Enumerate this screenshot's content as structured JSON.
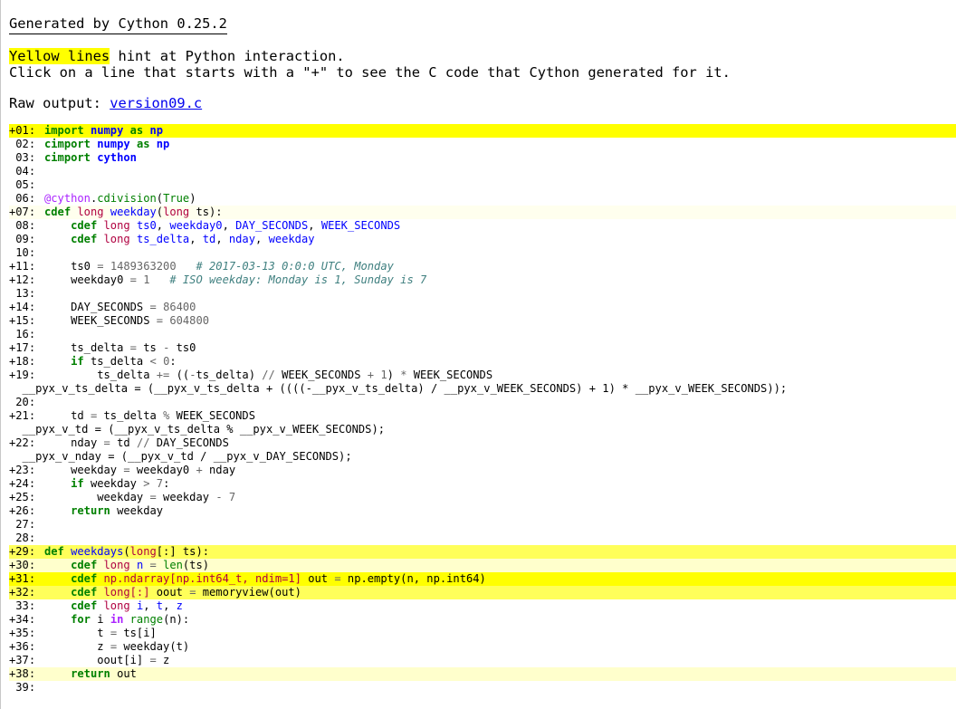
{
  "header": {
    "title": "Generated by Cython 0.25.2",
    "hint_highlight": "Yellow lines",
    "hint_rest": " hint at Python interaction.",
    "hint_line2": "Click on a line that starts with a \"+\" to see the C code that Cython generated for it.",
    "raw_label": "Raw output: ",
    "raw_link": "version09.c"
  },
  "colors": {
    "yellow_strong": "#ffff00",
    "yellow_mid": "#ffff5a",
    "yellow_light": "#ffffcc",
    "yellow_faint": "#ffffee",
    "link": "#0000ee"
  },
  "lines": [
    {
      "no": "+01:",
      "bg": "#ffff00",
      "tokens": [
        [
          "kw",
          "import"
        ],
        [
          "c",
          " "
        ],
        [
          "mod",
          "numpy"
        ],
        [
          "c",
          " "
        ],
        [
          "kw",
          "as"
        ],
        [
          "c",
          " "
        ],
        [
          "mod",
          "np"
        ]
      ]
    },
    {
      "no": " 02:",
      "bg": "",
      "tokens": [
        [
          "kw",
          "cimport"
        ],
        [
          "c",
          " "
        ],
        [
          "mod",
          "numpy"
        ],
        [
          "c",
          " "
        ],
        [
          "kw",
          "as"
        ],
        [
          "c",
          " "
        ],
        [
          "mod",
          "np"
        ]
      ]
    },
    {
      "no": " 03:",
      "bg": "",
      "tokens": [
        [
          "kw",
          "cimport"
        ],
        [
          "c",
          " "
        ],
        [
          "mod",
          "cython"
        ]
      ]
    },
    {
      "no": " 04:",
      "bg": "",
      "tokens": []
    },
    {
      "no": " 05:",
      "bg": "",
      "tokens": []
    },
    {
      "no": " 06:",
      "bg": "",
      "tokens": [
        [
          "deco",
          "@cython"
        ],
        [
          "c",
          "."
        ],
        [
          "bi",
          "cdivision"
        ],
        [
          "c",
          "("
        ],
        [
          "bi",
          "True"
        ],
        [
          "c",
          ")"
        ]
      ]
    },
    {
      "no": "+07:",
      "bg": "#ffffee",
      "tokens": [
        [
          "kw",
          "cdef"
        ],
        [
          "c",
          " "
        ],
        [
          "type",
          "long"
        ],
        [
          "c",
          " "
        ],
        [
          "name",
          "weekday"
        ],
        [
          "c",
          "("
        ],
        [
          "type",
          "long"
        ],
        [
          "c",
          " ts):"
        ]
      ]
    },
    {
      "no": " 08:",
      "bg": "",
      "tokens": [
        [
          "c",
          "    "
        ],
        [
          "kw",
          "cdef"
        ],
        [
          "c",
          " "
        ],
        [
          "type",
          "long"
        ],
        [
          "c",
          " "
        ],
        [
          "name",
          "ts0"
        ],
        [
          "c",
          ", "
        ],
        [
          "name",
          "weekday0"
        ],
        [
          "c",
          ", "
        ],
        [
          "name",
          "DAY_SECONDS"
        ],
        [
          "c",
          ", "
        ],
        [
          "name",
          "WEEK_SECONDS"
        ]
      ]
    },
    {
      "no": " 09:",
      "bg": "",
      "tokens": [
        [
          "c",
          "    "
        ],
        [
          "kw",
          "cdef"
        ],
        [
          "c",
          " "
        ],
        [
          "type",
          "long"
        ],
        [
          "c",
          " "
        ],
        [
          "name",
          "ts_delta"
        ],
        [
          "c",
          ", "
        ],
        [
          "name",
          "td"
        ],
        [
          "c",
          ", "
        ],
        [
          "name",
          "nday"
        ],
        [
          "c",
          ", "
        ],
        [
          "name",
          "weekday"
        ]
      ]
    },
    {
      "no": " 10:",
      "bg": "",
      "tokens": []
    },
    {
      "no": "+11:",
      "bg": "",
      "tokens": [
        [
          "c",
          "    ts0 "
        ],
        [
          "op",
          "="
        ],
        [
          "c",
          " "
        ],
        [
          "num",
          "1489363200"
        ],
        [
          "c",
          "   "
        ],
        [
          "cm",
          "# 2017-03-13 0:0:0 UTC, Monday"
        ]
      ]
    },
    {
      "no": "+12:",
      "bg": "",
      "tokens": [
        [
          "c",
          "    weekday0 "
        ],
        [
          "op",
          "="
        ],
        [
          "c",
          " "
        ],
        [
          "num",
          "1"
        ],
        [
          "c",
          "   "
        ],
        [
          "cm",
          "# ISO weekday: Monday is 1, Sunday is 7"
        ]
      ]
    },
    {
      "no": " 13:",
      "bg": "",
      "tokens": []
    },
    {
      "no": "+14:",
      "bg": "",
      "tokens": [
        [
          "c",
          "    DAY_SECONDS "
        ],
        [
          "op",
          "="
        ],
        [
          "c",
          " "
        ],
        [
          "num",
          "86400"
        ]
      ]
    },
    {
      "no": "+15:",
      "bg": "",
      "tokens": [
        [
          "c",
          "    WEEK_SECONDS "
        ],
        [
          "op",
          "="
        ],
        [
          "c",
          " "
        ],
        [
          "num",
          "604800"
        ]
      ]
    },
    {
      "no": " 16:",
      "bg": "",
      "tokens": []
    },
    {
      "no": "+17:",
      "bg": "",
      "tokens": [
        [
          "c",
          "    ts_delta "
        ],
        [
          "op",
          "="
        ],
        [
          "c",
          " ts "
        ],
        [
          "op",
          "-"
        ],
        [
          "c",
          " ts0"
        ]
      ]
    },
    {
      "no": "+18:",
      "bg": "",
      "tokens": [
        [
          "c",
          "    "
        ],
        [
          "kw",
          "if"
        ],
        [
          "c",
          " ts_delta "
        ],
        [
          "op",
          "<"
        ],
        [
          "c",
          " "
        ],
        [
          "num",
          "0"
        ],
        [
          "c",
          ":"
        ]
      ]
    },
    {
      "no": "+19:",
      "bg": "",
      "tokens": [
        [
          "c",
          "        ts_delta "
        ],
        [
          "op",
          "+="
        ],
        [
          "c",
          " (("
        ],
        [
          "op",
          "-"
        ],
        [
          "c",
          "ts_delta) "
        ],
        [
          "op",
          "//"
        ],
        [
          "c",
          " WEEK_SECONDS "
        ],
        [
          "op",
          "+"
        ],
        [
          "c",
          " "
        ],
        [
          "num",
          "1"
        ],
        [
          "c",
          ") "
        ],
        [
          "op",
          "*"
        ],
        [
          "c",
          " WEEK_SECONDS"
        ]
      ]
    },
    {
      "no": "",
      "bg": "",
      "tokens": [
        [
          "c",
          "  __pyx_v_ts_delta = (__pyx_v_ts_delta + ((((-__pyx_v_ts_delta) / __pyx_v_WEEK_SECONDS) + 1) * __pyx_v_WEEK_SECONDS));"
        ]
      ]
    },
    {
      "no": " 20:",
      "bg": "",
      "tokens": []
    },
    {
      "no": "+21:",
      "bg": "",
      "tokens": [
        [
          "c",
          "    td "
        ],
        [
          "op",
          "="
        ],
        [
          "c",
          " ts_delta "
        ],
        [
          "op",
          "%"
        ],
        [
          "c",
          " WEEK_SECONDS"
        ]
      ]
    },
    {
      "no": "",
      "bg": "",
      "tokens": [
        [
          "c",
          "  __pyx_v_td = (__pyx_v_ts_delta % __pyx_v_WEEK_SECONDS);"
        ]
      ]
    },
    {
      "no": "+22:",
      "bg": "",
      "tokens": [
        [
          "c",
          "    nday "
        ],
        [
          "op",
          "="
        ],
        [
          "c",
          " td "
        ],
        [
          "op",
          "//"
        ],
        [
          "c",
          " DAY_SECONDS"
        ]
      ]
    },
    {
      "no": "",
      "bg": "",
      "tokens": [
        [
          "c",
          "  __pyx_v_nday = (__pyx_v_td / __pyx_v_DAY_SECONDS);"
        ]
      ]
    },
    {
      "no": "+23:",
      "bg": "",
      "tokens": [
        [
          "c",
          "    weekday "
        ],
        [
          "op",
          "="
        ],
        [
          "c",
          " weekday0 "
        ],
        [
          "op",
          "+"
        ],
        [
          "c",
          " nday"
        ]
      ]
    },
    {
      "no": "+24:",
      "bg": "",
      "tokens": [
        [
          "c",
          "    "
        ],
        [
          "kw",
          "if"
        ],
        [
          "c",
          " weekday "
        ],
        [
          "op",
          ">"
        ],
        [
          "c",
          " "
        ],
        [
          "num",
          "7"
        ],
        [
          "c",
          ":"
        ]
      ]
    },
    {
      "no": "+25:",
      "bg": "",
      "tokens": [
        [
          "c",
          "        weekday "
        ],
        [
          "op",
          "="
        ],
        [
          "c",
          " weekday "
        ],
        [
          "op",
          "-"
        ],
        [
          "c",
          " "
        ],
        [
          "num",
          "7"
        ]
      ]
    },
    {
      "no": "+26:",
      "bg": "",
      "tokens": [
        [
          "c",
          "    "
        ],
        [
          "kw",
          "return"
        ],
        [
          "c",
          " weekday"
        ]
      ]
    },
    {
      "no": " 27:",
      "bg": "",
      "tokens": []
    },
    {
      "no": " 28:",
      "bg": "",
      "tokens": []
    },
    {
      "no": "+29:",
      "bg": "#ffff5a",
      "tokens": [
        [
          "kw",
          "def"
        ],
        [
          "c",
          " "
        ],
        [
          "name",
          "weekdays"
        ],
        [
          "c",
          "("
        ],
        [
          "type",
          "long"
        ],
        [
          "c",
          "[:] ts):"
        ]
      ]
    },
    {
      "no": "+30:",
      "bg": "#ffffcc",
      "tokens": [
        [
          "c",
          "    "
        ],
        [
          "kw",
          "cdef"
        ],
        [
          "c",
          " "
        ],
        [
          "type",
          "long"
        ],
        [
          "c",
          " "
        ],
        [
          "name",
          "n"
        ],
        [
          "c",
          " "
        ],
        [
          "op",
          "="
        ],
        [
          "c",
          " "
        ],
        [
          "bi",
          "len"
        ],
        [
          "c",
          "(ts)"
        ]
      ]
    },
    {
      "no": "+31:",
      "bg": "#ffff00",
      "tokens": [
        [
          "c",
          "    "
        ],
        [
          "kw",
          "cdef"
        ],
        [
          "c",
          " "
        ],
        [
          "type",
          "np.ndarray[np.int64_t, ndim=1]"
        ],
        [
          "c",
          " out "
        ],
        [
          "op",
          "="
        ],
        [
          "c",
          " np.empty(n, np.int64)"
        ]
      ]
    },
    {
      "no": "+32:",
      "bg": "#ffff5a",
      "tokens": [
        [
          "c",
          "    "
        ],
        [
          "kw",
          "cdef"
        ],
        [
          "c",
          " "
        ],
        [
          "type",
          "long[:]"
        ],
        [
          "c",
          " oout "
        ],
        [
          "op",
          "="
        ],
        [
          "c",
          " memoryview(out)"
        ]
      ]
    },
    {
      "no": " 33:",
      "bg": "",
      "tokens": [
        [
          "c",
          "    "
        ],
        [
          "kw",
          "cdef"
        ],
        [
          "c",
          " "
        ],
        [
          "type",
          "long"
        ],
        [
          "c",
          " "
        ],
        [
          "name",
          "i"
        ],
        [
          "c",
          ", "
        ],
        [
          "name",
          "t"
        ],
        [
          "c",
          ", "
        ],
        [
          "name",
          "z"
        ]
      ]
    },
    {
      "no": "+34:",
      "bg": "",
      "tokens": [
        [
          "c",
          "    "
        ],
        [
          "kw",
          "for"
        ],
        [
          "c",
          " i "
        ],
        [
          "in",
          "in"
        ],
        [
          "c",
          " "
        ],
        [
          "bi",
          "range"
        ],
        [
          "c",
          "(n):"
        ]
      ]
    },
    {
      "no": "+35:",
      "bg": "",
      "tokens": [
        [
          "c",
          "        t "
        ],
        [
          "op",
          "="
        ],
        [
          "c",
          " ts[i]"
        ]
      ]
    },
    {
      "no": "+36:",
      "bg": "",
      "tokens": [
        [
          "c",
          "        z "
        ],
        [
          "op",
          "="
        ],
        [
          "c",
          " weekday(t)"
        ]
      ]
    },
    {
      "no": "+37:",
      "bg": "",
      "tokens": [
        [
          "c",
          "        oout[i] "
        ],
        [
          "op",
          "="
        ],
        [
          "c",
          " z"
        ]
      ]
    },
    {
      "no": "+38:",
      "bg": "#ffffcc",
      "tokens": [
        [
          "c",
          "    "
        ],
        [
          "kw",
          "return"
        ],
        [
          "c",
          " out"
        ]
      ]
    },
    {
      "no": " 39:",
      "bg": "",
      "tokens": []
    }
  ]
}
